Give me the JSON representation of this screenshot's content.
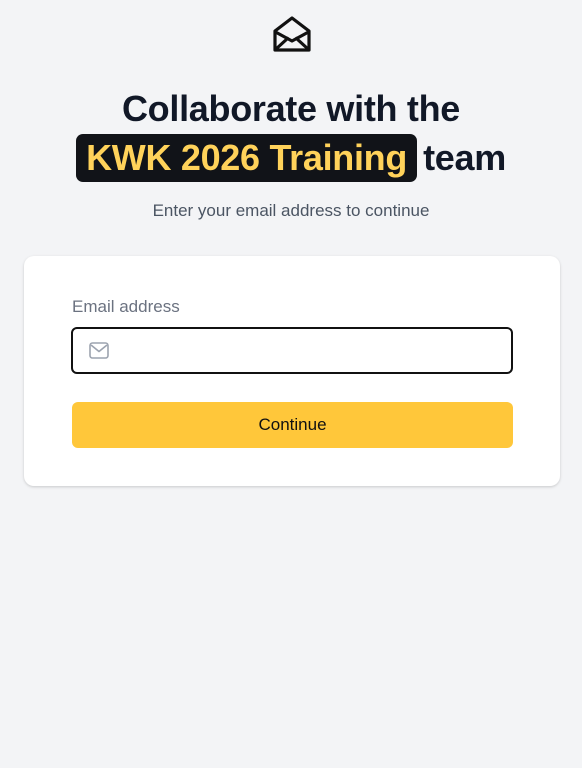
{
  "header": {
    "logo_icon": "envelope-open-icon",
    "title_line1": "Collaborate with the",
    "title_highlight": "KWK 2026 Training",
    "title_suffix": "team",
    "subtitle": "Enter your email address to continue"
  },
  "form": {
    "email_label": "Email address",
    "email_value": "",
    "email_placeholder": "",
    "email_icon": "mail-icon",
    "continue_label": "Continue"
  },
  "colors": {
    "background": "#f3f4f6",
    "highlight_bg": "#111318",
    "highlight_text": "#ffd25a",
    "button": "#ffc73a",
    "heading": "#111827"
  }
}
